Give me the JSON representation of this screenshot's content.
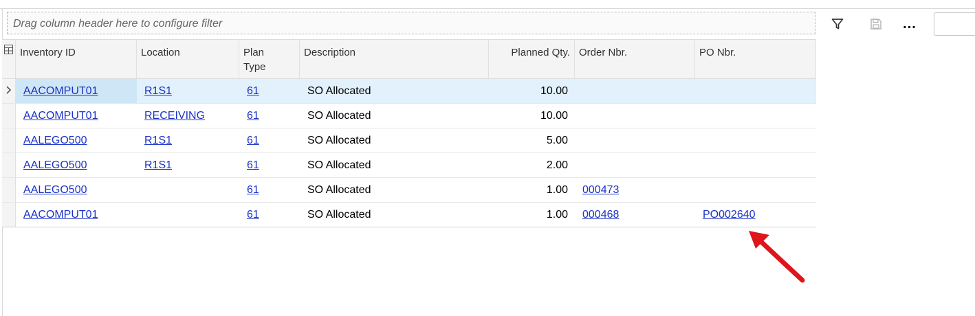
{
  "toolbar": {
    "filter_placeholder": "Drag column header here to configure filter",
    "more_label": "...",
    "icons": [
      "filter-icon",
      "save-icon",
      "more-icon"
    ]
  },
  "grid": {
    "columns": {
      "inventory_id": "Inventory ID",
      "location": "Location",
      "plan_type_1": "Plan",
      "plan_type_2": "Type",
      "description": "Description",
      "planned_qty": "Planned Qty.",
      "order_nbr": "Order Nbr.",
      "po_nbr": "PO Nbr."
    },
    "rows": [
      {
        "inventory_id": "AACOMPUT01",
        "location": "R1S1",
        "plan_type": "61",
        "description": "SO Allocated",
        "planned_qty": "10.00",
        "order_nbr": "",
        "po_nbr": ""
      },
      {
        "inventory_id": "AACOMPUT01",
        "location": "RECEIVING",
        "plan_type": "61",
        "description": "SO Allocated",
        "planned_qty": "10.00",
        "order_nbr": "",
        "po_nbr": ""
      },
      {
        "inventory_id": "AALEGO500",
        "location": "R1S1",
        "plan_type": "61",
        "description": "SO Allocated",
        "planned_qty": "5.00",
        "order_nbr": "",
        "po_nbr": ""
      },
      {
        "inventory_id": "AALEGO500",
        "location": "R1S1",
        "plan_type": "61",
        "description": "SO Allocated",
        "planned_qty": "2.00",
        "order_nbr": "",
        "po_nbr": ""
      },
      {
        "inventory_id": "AALEGO500",
        "location": "",
        "plan_type": "61",
        "description": "SO Allocated",
        "planned_qty": "1.00",
        "order_nbr": "000473",
        "po_nbr": ""
      },
      {
        "inventory_id": "AACOMPUT01",
        "location": "",
        "plan_type": "61",
        "description": "SO Allocated",
        "planned_qty": "1.00",
        "order_nbr": "000468",
        "po_nbr": "PO002640"
      }
    ]
  },
  "colors": {
    "link": "#1a32c8",
    "selected_row": "#e2f1fb",
    "annotation_arrow": "#e0141b"
  }
}
